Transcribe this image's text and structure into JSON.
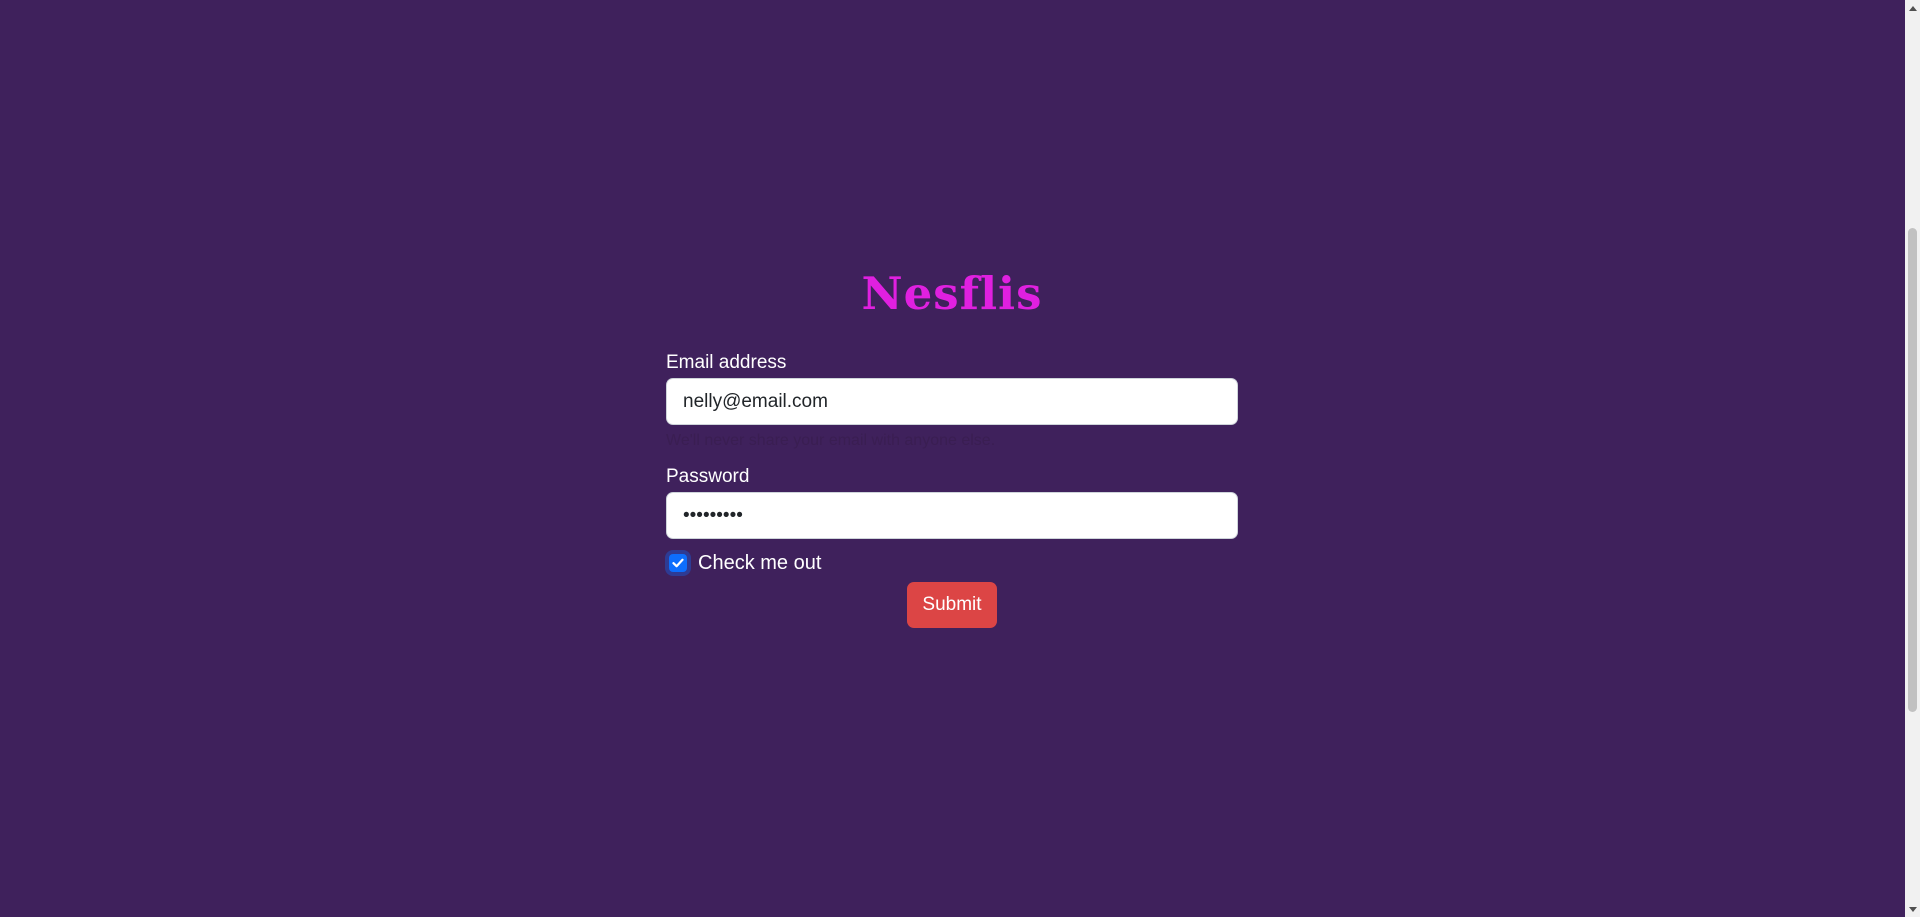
{
  "brand": {
    "title": "Nesflis"
  },
  "form": {
    "email": {
      "label": "Email address",
      "value": "nelly@email.com",
      "help": "We'll never share your email with anyone else."
    },
    "password": {
      "label": "Password",
      "value": "•••••••••"
    },
    "checkbox": {
      "label": "Check me out",
      "checked": true
    },
    "submit_label": "Submit"
  },
  "colors": {
    "background": "#3f215c",
    "brand": "#e020e0",
    "button": "#dc4545",
    "checkbox": "#0d6efd"
  },
  "icons": {
    "checkbox": "check-icon",
    "scroll_up": "scroll-up-arrow-icon",
    "scroll_down": "scroll-down-arrow-icon"
  }
}
